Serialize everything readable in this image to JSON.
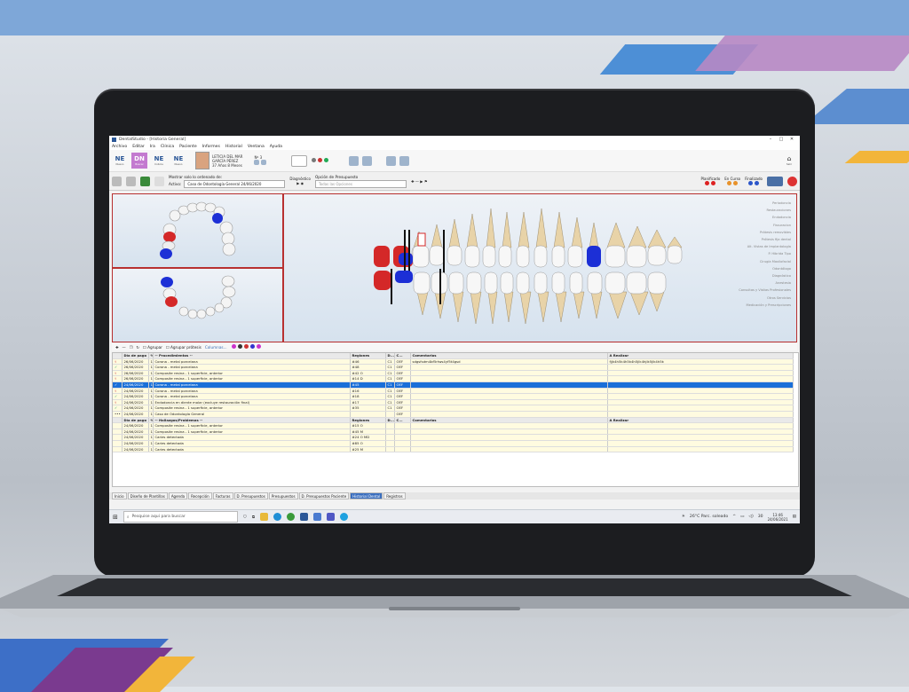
{
  "window": {
    "title": "DentalStudio - [Historia General]",
    "minimize": "–",
    "maximize": "□",
    "close": "✕"
  },
  "menu": [
    "Archivo",
    "Editar",
    "Ira",
    "Clínica",
    "Paciente",
    "Informes",
    "Historial",
    "Ventana",
    "Ayuda"
  ],
  "toolbar": {
    "modules": [
      {
        "code": "NE",
        "caption": "Nuevo"
      },
      {
        "code": "DN",
        "caption": "Buscar"
      },
      {
        "code": "NE",
        "caption": "Cobros"
      },
      {
        "code": "NE",
        "caption": "Nuevo"
      }
    ],
    "patient": {
      "name1": "LETICIA DEL MAR",
      "name2": "GARCÍA PÉREZ",
      "age": "37 Años 8 Meses",
      "number": "Nº 3"
    },
    "right_icon_label": "Salir"
  },
  "toolbar2": {
    "mostrar_label": "Mostrar solo lo ordenado de:",
    "activo_label": "Activo:",
    "activo_value": "Caso de Odontología General 24/06/2020",
    "diagnostico_label": "Diagnóstico",
    "presupuesto_label": "Opción de Presupuesto",
    "presupuesto_value": "Todas las Opciones",
    "planificado": "Planificado",
    "encurso": "En Curso",
    "finalizado": "Finalizado"
  },
  "legend": [
    "Periodoncia",
    "Restauraciones",
    "Endodoncia",
    "Fissuracion",
    "Prótesis removibles",
    "Prótesis fija dental",
    "Alt. Vistas de Implantología",
    "P. Hibrida Tipo",
    "Cirugía Maxilofacial",
    "Odontólogo",
    "Diagnóstico",
    "Anestesia",
    "Consultas y Visitas Profesionales",
    "Otros Servicios",
    "Medicación y Prescripciones"
  ],
  "gridbar": {
    "agrupar": "Agrupar",
    "agrupar_prot": "Agrupar prótesis",
    "columnas": "Columnas..."
  },
  "grid": {
    "headers": [
      "Día de pago",
      "%",
      "-- Procedimientos --",
      "Regiones",
      "D...",
      "C...",
      "Comentarios",
      "A Realizar"
    ],
    "rows": [
      {
        "date": "26/06/2020",
        "pct": "1",
        "proc": "Corona - metal porcelana",
        "reg": "#46",
        "d": "C1",
        "c": "OEF",
        "com": "sdgsfsdm4bf5rtws4yf5t4gsd",
        "real": "fjjk4h5k4h5k4h5jlk4hjlk5jlk4h5k"
      },
      {
        "date": "26/06/2020",
        "pct": "1",
        "proc": "Corona - metal porcelana",
        "reg": "#48",
        "d": "C1",
        "c": "OEF",
        "com": "",
        "real": ""
      },
      {
        "date": "26/06/2020",
        "pct": "1",
        "proc": "Composite resina - 1 superficie, anterior",
        "reg": "#42 O",
        "d": "C1",
        "c": "OEF",
        "com": "",
        "real": ""
      },
      {
        "date": "26/06/2020",
        "pct": "1",
        "proc": "Composite resina - 1 superficie, anterior",
        "reg": "#14 D",
        "d": "C1",
        "c": "OEF",
        "com": "",
        "real": ""
      },
      {
        "date": "24/06/2020",
        "pct": "1",
        "proc": "Corona - metal porcelana",
        "reg": "#45",
        "d": "C1",
        "c": "OEF",
        "com": "",
        "real": "",
        "selected": true
      },
      {
        "date": "24/06/2020",
        "pct": "1",
        "proc": "Corona - metal porcelana",
        "reg": "#16",
        "d": "C1",
        "c": "OEF",
        "com": "",
        "real": ""
      },
      {
        "date": "24/06/2020",
        "pct": "1",
        "proc": "Corona - metal porcelana",
        "reg": "#18",
        "d": "C1",
        "c": "OEF",
        "com": "",
        "real": ""
      },
      {
        "date": "24/06/2020",
        "pct": "1",
        "proc": "Endodoncia en diente molar (excluye restauración final)",
        "reg": "#17",
        "d": "C1",
        "c": "OEF",
        "com": "",
        "real": ""
      },
      {
        "date": "24/06/2020",
        "pct": "1",
        "proc": "Composite resina - 1 superficie, anterior",
        "reg": "#35",
        "d": "C1",
        "c": "OEF",
        "com": "",
        "real": ""
      },
      {
        "date": "24/06/2020",
        "pct": "1",
        "proc": "Caso de Odontología General",
        "reg": "",
        "d": "",
        "c": "OEF",
        "com": "",
        "real": ""
      }
    ],
    "headers2": [
      "Día de pago",
      "%",
      "-- Hallazgos/Problemas --",
      "Regiones",
      "D...",
      "C...",
      "Comentarios",
      "A Realizar"
    ],
    "rows2": [
      {
        "date": "24/06/2020",
        "pct": "1",
        "proc": "Composite resina - 1 superficie, anterior",
        "reg": "#15 O"
      },
      {
        "date": "24/06/2020",
        "pct": "1",
        "proc": "Composite resina - 1 superficie, anterior",
        "reg": "#45 M"
      },
      {
        "date": "24/06/2020",
        "pct": "1",
        "proc": "Caries detectada",
        "reg": "#24 O MD"
      },
      {
        "date": "24/06/2020",
        "pct": "1",
        "proc": "Caries detectada",
        "reg": "#85 O"
      },
      {
        "date": "24/06/2020",
        "pct": "1",
        "proc": "Caries detectada",
        "reg": "#25 M"
      }
    ]
  },
  "tabs": [
    "Inicio",
    "Diseño de Plantillas",
    "Agenda",
    "Recepción",
    "Facturas",
    "D. Presupuestos",
    "Presupuestos",
    "D. Presupuestos Paciente",
    "Historial Dental",
    "Registros"
  ],
  "active_tab": "Historial Dental",
  "taskbar": {
    "search_placeholder": "Pesquise aqui para buscar",
    "weather": "26°C  Parc. soleado",
    "time": "13:46",
    "date": "24/06/2021",
    "notif": "30"
  }
}
